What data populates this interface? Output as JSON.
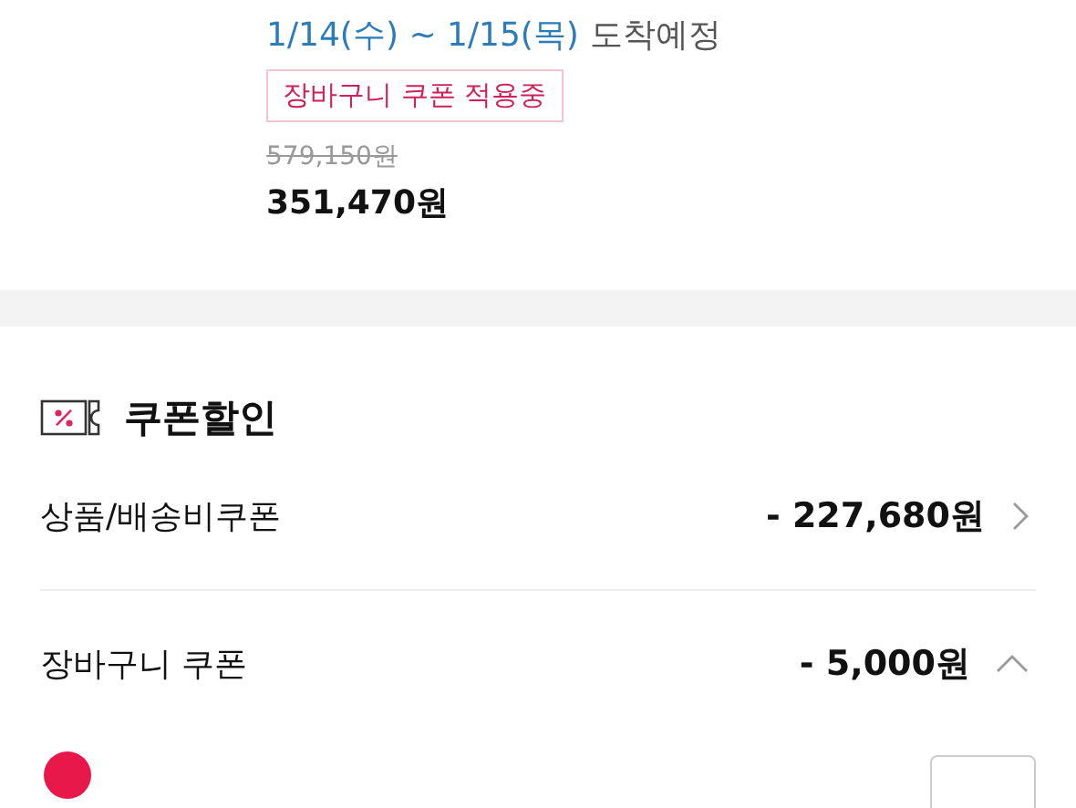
{
  "product": {
    "delivery_date": "1/14(수) ~ 1/15(목)",
    "delivery_label": "도착예정",
    "badge": "장바구니 쿠폰 적용중",
    "original_price": "579,150원",
    "price": "351,470원"
  },
  "coupon_section": {
    "title": "쿠폰할인",
    "rows": [
      {
        "kind": "link",
        "label": "상품/배송비쿠폰",
        "amount": "- 227,680원"
      },
      {
        "kind": "toggle",
        "label": "장바구니 쿠폰",
        "amount": "- 5,000원",
        "expanded": true
      }
    ]
  }
}
